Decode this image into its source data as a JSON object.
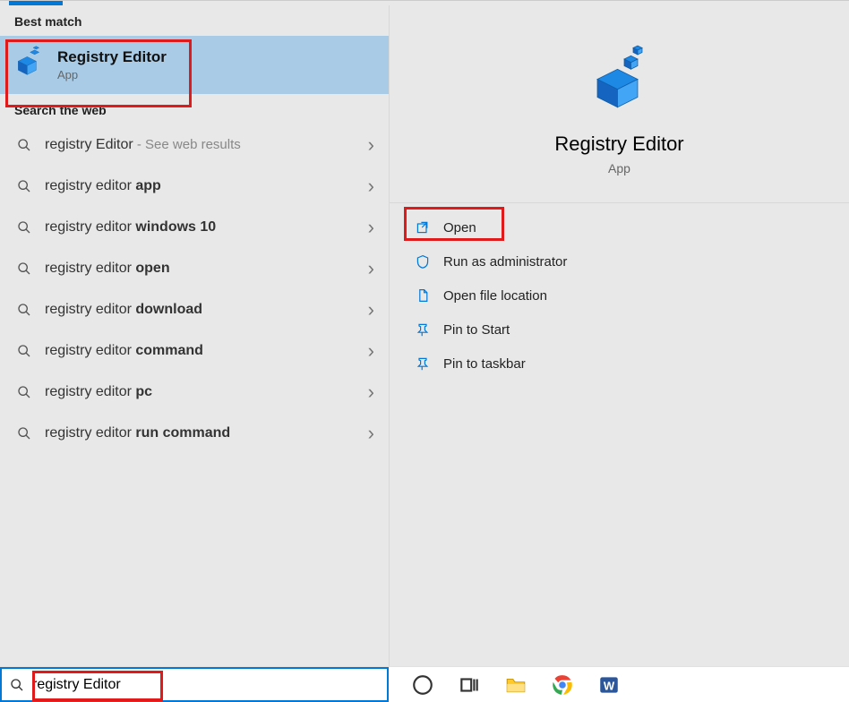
{
  "sections": {
    "best_match_label": "Best match",
    "search_web_label": "Search the web"
  },
  "best_match": {
    "title": "Registry Editor",
    "subtitle": "App"
  },
  "web_results": [
    {
      "prefix": "registry Editor",
      "bold": "",
      "suffix": " - See web results"
    },
    {
      "prefix": "registry editor ",
      "bold": "app",
      "suffix": ""
    },
    {
      "prefix": "registry editor ",
      "bold": "windows 10",
      "suffix": ""
    },
    {
      "prefix": "registry editor ",
      "bold": "open",
      "suffix": ""
    },
    {
      "prefix": "registry editor ",
      "bold": "download",
      "suffix": ""
    },
    {
      "prefix": "registry editor ",
      "bold": "command",
      "suffix": ""
    },
    {
      "prefix": "registry editor ",
      "bold": "pc",
      "suffix": ""
    },
    {
      "prefix": "registry editor ",
      "bold": "run command",
      "suffix": ""
    }
  ],
  "details": {
    "title": "Registry Editor",
    "subtitle": "App",
    "actions": [
      {
        "id": "open",
        "label": "Open",
        "icon": "open-icon"
      },
      {
        "id": "run-admin",
        "label": "Run as administrator",
        "icon": "shield-icon"
      },
      {
        "id": "open-loc",
        "label": "Open file location",
        "icon": "file-icon"
      },
      {
        "id": "pin-start",
        "label": "Pin to Start",
        "icon": "pin-icon"
      },
      {
        "id": "pin-task",
        "label": "Pin to taskbar",
        "icon": "pin-icon"
      }
    ]
  },
  "search": {
    "query": "registry Editor"
  }
}
